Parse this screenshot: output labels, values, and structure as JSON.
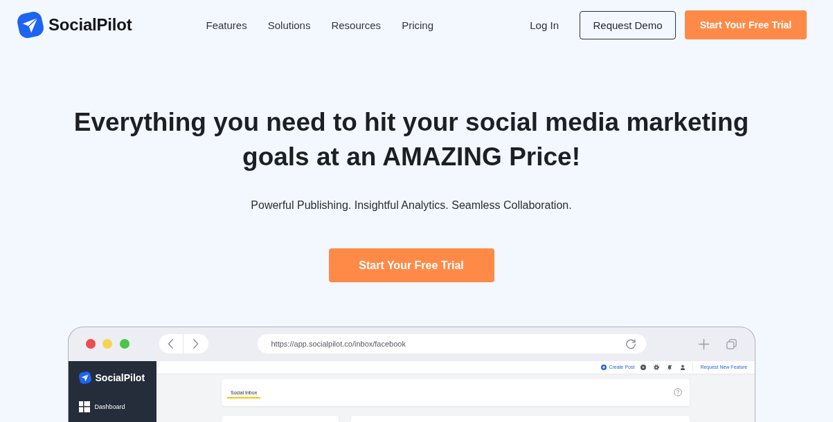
{
  "header": {
    "logo": "SocialPilot",
    "nav": [
      {
        "label": "Features"
      },
      {
        "label": "Solutions"
      },
      {
        "label": "Resources"
      },
      {
        "label": "Pricing"
      }
    ],
    "login": "Log In",
    "buttons": [
      {
        "kind": "outline",
        "label": "Request Demo"
      },
      {
        "kind": "primary",
        "label": "Start Your Free Trial"
      }
    ]
  },
  "hero": {
    "headline": "Everything you need to hit your social media marketing goals at an AMAZING Price!",
    "subtitle": "Powerful Publishing. Insightful Analytics. Seamless Collaboration.",
    "cta": "Start Your Free Trial"
  },
  "mockup": {
    "url": "https://app.socialpilot.co/inbox/facebook",
    "sidebar": {
      "logo": "SocialPilot",
      "items": [
        {
          "label": "Dashboard"
        }
      ]
    },
    "topbar": {
      "create_post": "Create Post",
      "request_feature": "Request New Feature"
    },
    "tabs": [
      {
        "label": "Social Inbox",
        "selected": true
      }
    ]
  }
}
